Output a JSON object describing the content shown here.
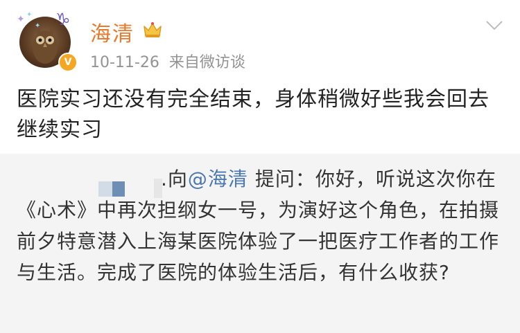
{
  "header": {
    "username": "海清",
    "timestamp": "10-11-26",
    "source": "来自微访谈",
    "badge": "V"
  },
  "post": {
    "text": "医院实习还没有完全结束，身体稍微好些我会回去继续实习"
  },
  "quote": {
    "prefix": ".向",
    "mention": "@海清",
    "body": " 提问：你好，听说这次你在《心术》中再次担纲女一号，为演好这个角色，在拍摄前夕特意潜入上海某医院体验了一把医疗工作者的工作与生活。完成了医院的体验生活后，有什么收获?"
  },
  "icons": {
    "avatar": "owl-avatar",
    "crown": "crown-icon",
    "verified": "verified-badge-icon",
    "more": "chevron-down-icon"
  },
  "colors": {
    "username": "#e87a2d",
    "mention": "#4a77b0",
    "meta": "#939393",
    "quote_bg": "#f4f4f4",
    "verified": "#f5a623"
  }
}
